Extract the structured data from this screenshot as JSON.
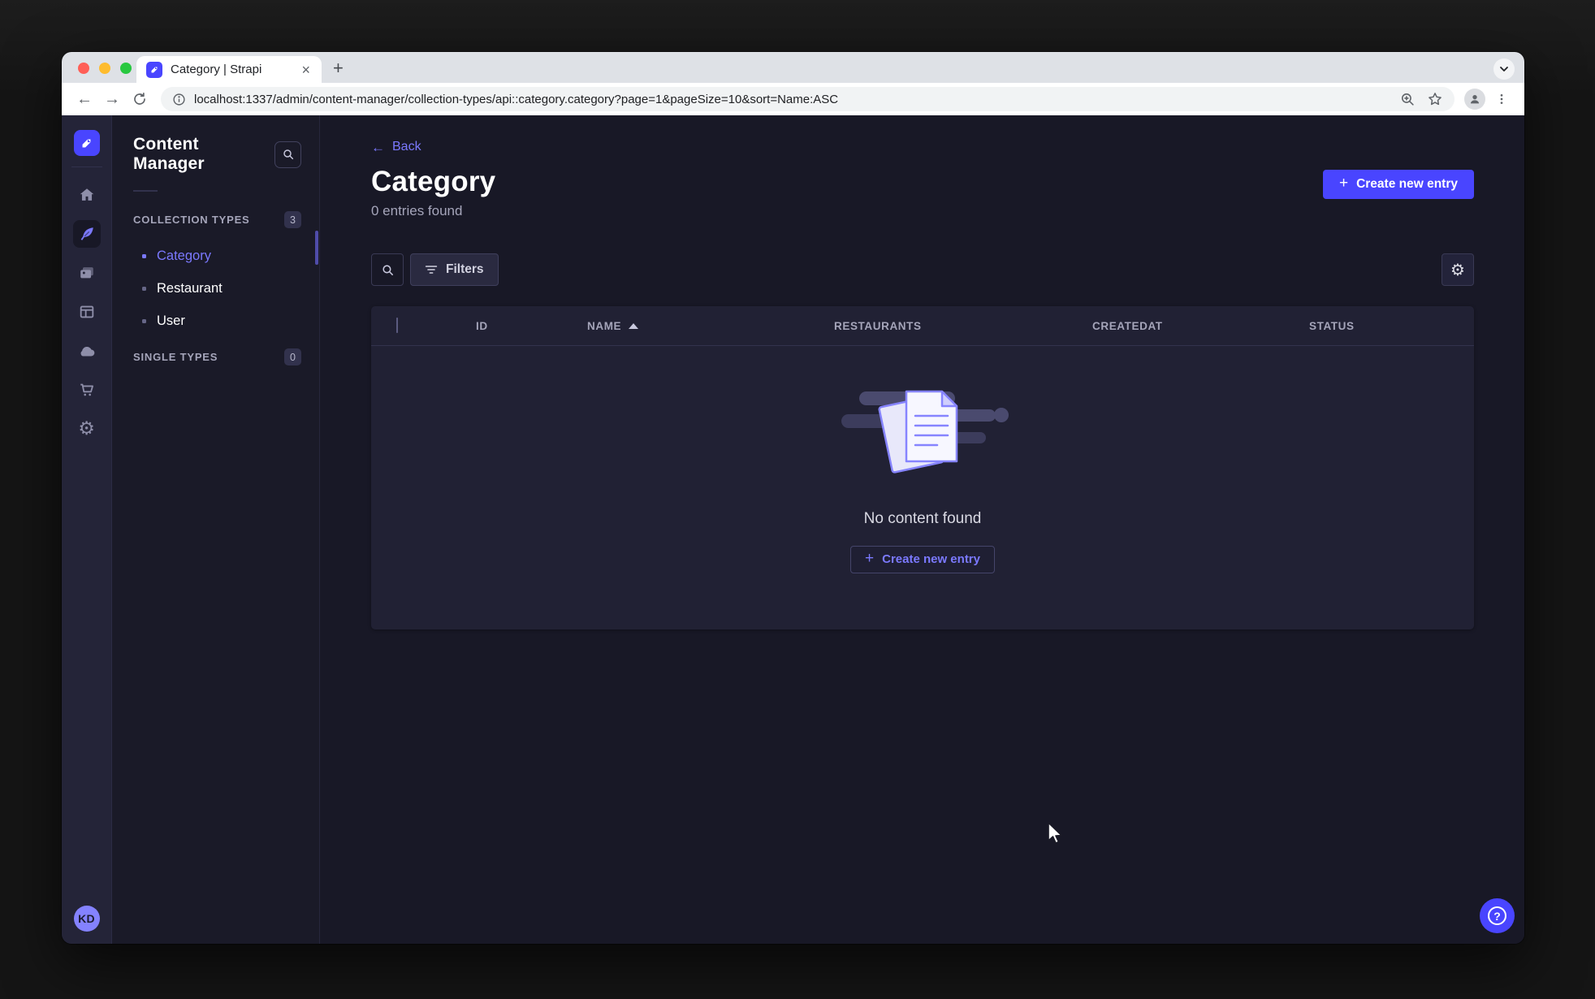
{
  "browser": {
    "tab_title": "Category | Strapi",
    "new_tab_glyph": "+",
    "close_glyph": "×",
    "back_glyph": "←",
    "forward_glyph": "→",
    "url": "localhost:1337/admin/content-manager/collection-types/api::category.category?page=1&pageSize=10&sort=Name:ASC"
  },
  "rail": {
    "items": [
      "home",
      "content-manager",
      "media-library",
      "content-type-builder",
      "deploy-cloud",
      "marketplace",
      "settings"
    ],
    "active_item": "content-manager",
    "gear_glyph": "⚙",
    "avatar_initials": "KD"
  },
  "subnav": {
    "title": "Content Manager",
    "sections": [
      {
        "label": "COLLECTION TYPES",
        "count": "3"
      },
      {
        "label": "SINGLE TYPES",
        "count": "0"
      }
    ],
    "items": [
      {
        "label": "Category"
      },
      {
        "label": "Restaurant"
      },
      {
        "label": "User"
      }
    ]
  },
  "main": {
    "back_label": "Back",
    "title": "Category",
    "subtitle": "0 entries found",
    "create_button": "Create new entry",
    "filters_button": "Filters",
    "gear_glyph": "⚙",
    "table": {
      "columns": [
        "ID",
        "NAME",
        "RESTAURANTS",
        "CREATEDAT",
        "STATUS"
      ],
      "sorted_column": "NAME",
      "sort_direction": "ASC",
      "rows": []
    },
    "empty": {
      "message": "No content found",
      "create_button": "Create new entry"
    },
    "help_glyph": "?"
  },
  "colors": {
    "primary": "#4945ff",
    "link": "#7b79ff",
    "page_bg": "#181826",
    "card_bg": "#212134",
    "muted_text": "#a5a5ba"
  }
}
